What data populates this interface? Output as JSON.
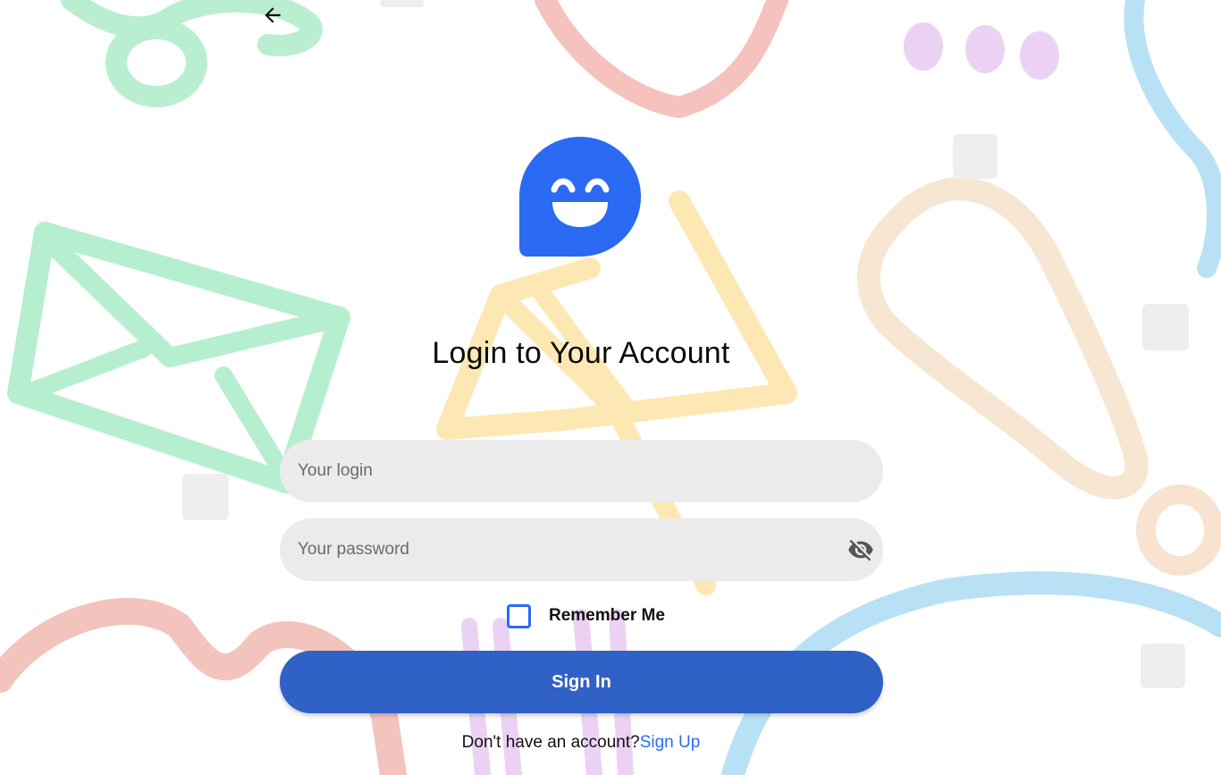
{
  "navigation": {
    "back_icon": "arrow-left-icon"
  },
  "logo": {
    "icon": "smiling-chat-bubble-icon",
    "color": "#2b6af2"
  },
  "title": "Login to Your Account",
  "login": {
    "placeholder": "Your login",
    "value": ""
  },
  "password": {
    "placeholder": "Your password",
    "value": "",
    "toggle_icon": "eye-off-icon"
  },
  "remember": {
    "label": "Remember Me",
    "checked": false
  },
  "sign_in": {
    "label": "Sign In"
  },
  "signup": {
    "prompt": "Don't have an account?",
    "link": "Sign Up"
  },
  "colors": {
    "accent": "#2c6cf5",
    "button": "#3061c6",
    "field_bg": "#ebebeb"
  }
}
